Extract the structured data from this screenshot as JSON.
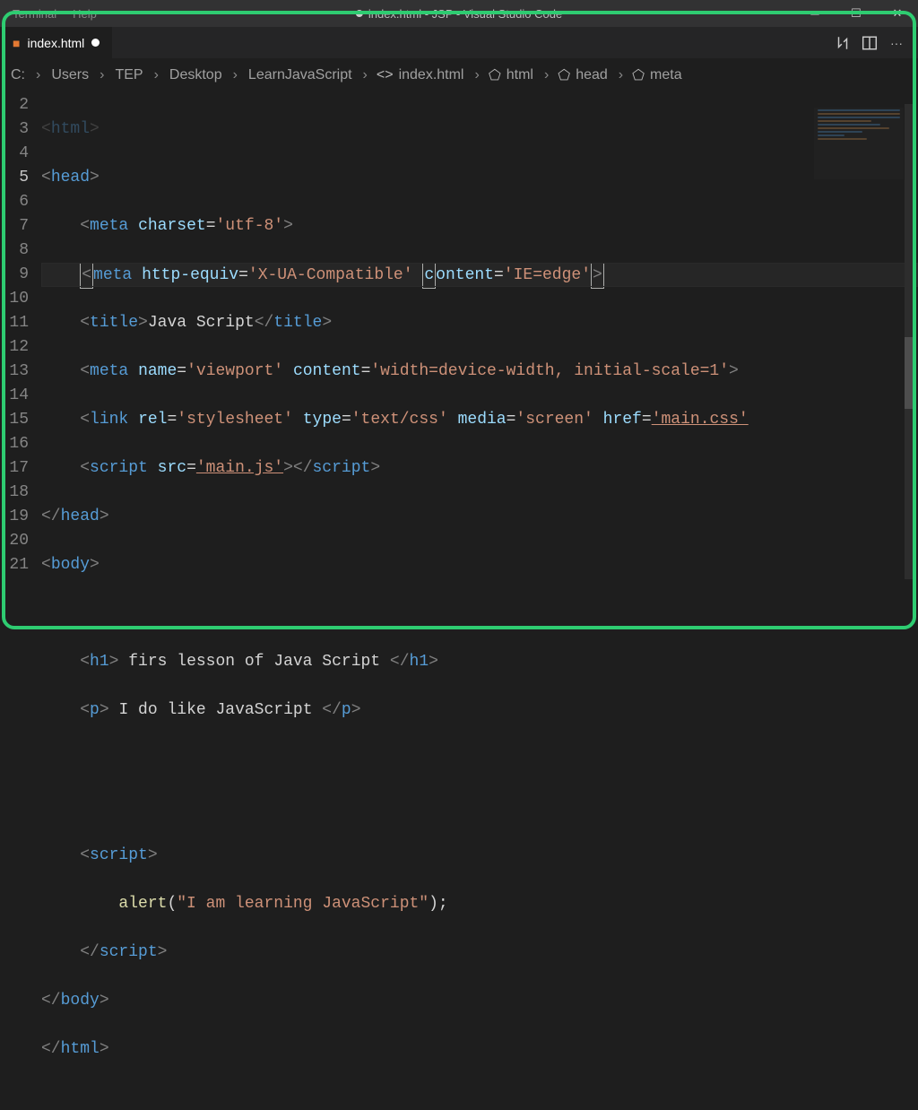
{
  "menu": {
    "terminal": "Terminal",
    "help": "Help"
  },
  "window_title": "index.html - JSP - Visual Studio Code",
  "tab": {
    "name": "index.html",
    "modified": true
  },
  "breadcrumb": [
    "C:",
    "Users",
    "TEP",
    "Desktop",
    "LearnJavaScript",
    "index.html",
    "html",
    "head",
    "meta"
  ],
  "lines": {
    "start": 2,
    "current": 5,
    "n2": "<html>",
    "n3": "<head>",
    "n4": "    <meta charset='utf-8'>",
    "n5": "    <meta http-equiv='X-UA-Compatible' content='IE=edge'>",
    "n6": "    <title>Java Script</title>",
    "n7": "    <meta name='viewport' content='width=device-width, initial-scale=1'>",
    "n8": "    <link rel='stylesheet' type='text/css' media='screen' href='main.css'",
    "n9": "    <script src='main.js'></script>",
    "n10": "</head>",
    "n11": "<body>",
    "n12": "",
    "n13": "    <h1> firs lesson of Java Script </h1>",
    "n14": "    <p> I do like JavaScript </p>",
    "n15": "",
    "n16": "",
    "n17": "    <script>",
    "n18": "        alert(\"I am learning JavaScript\");",
    "n19": "    </script>",
    "n20": "</body>",
    "n21": "</html>"
  },
  "gutter": [
    "2",
    "3",
    "4",
    "5",
    "6",
    "7",
    "8",
    "9",
    "10",
    "11",
    "12",
    "13",
    "14",
    "15",
    "16",
    "17",
    "18",
    "19",
    "20",
    "21"
  ]
}
